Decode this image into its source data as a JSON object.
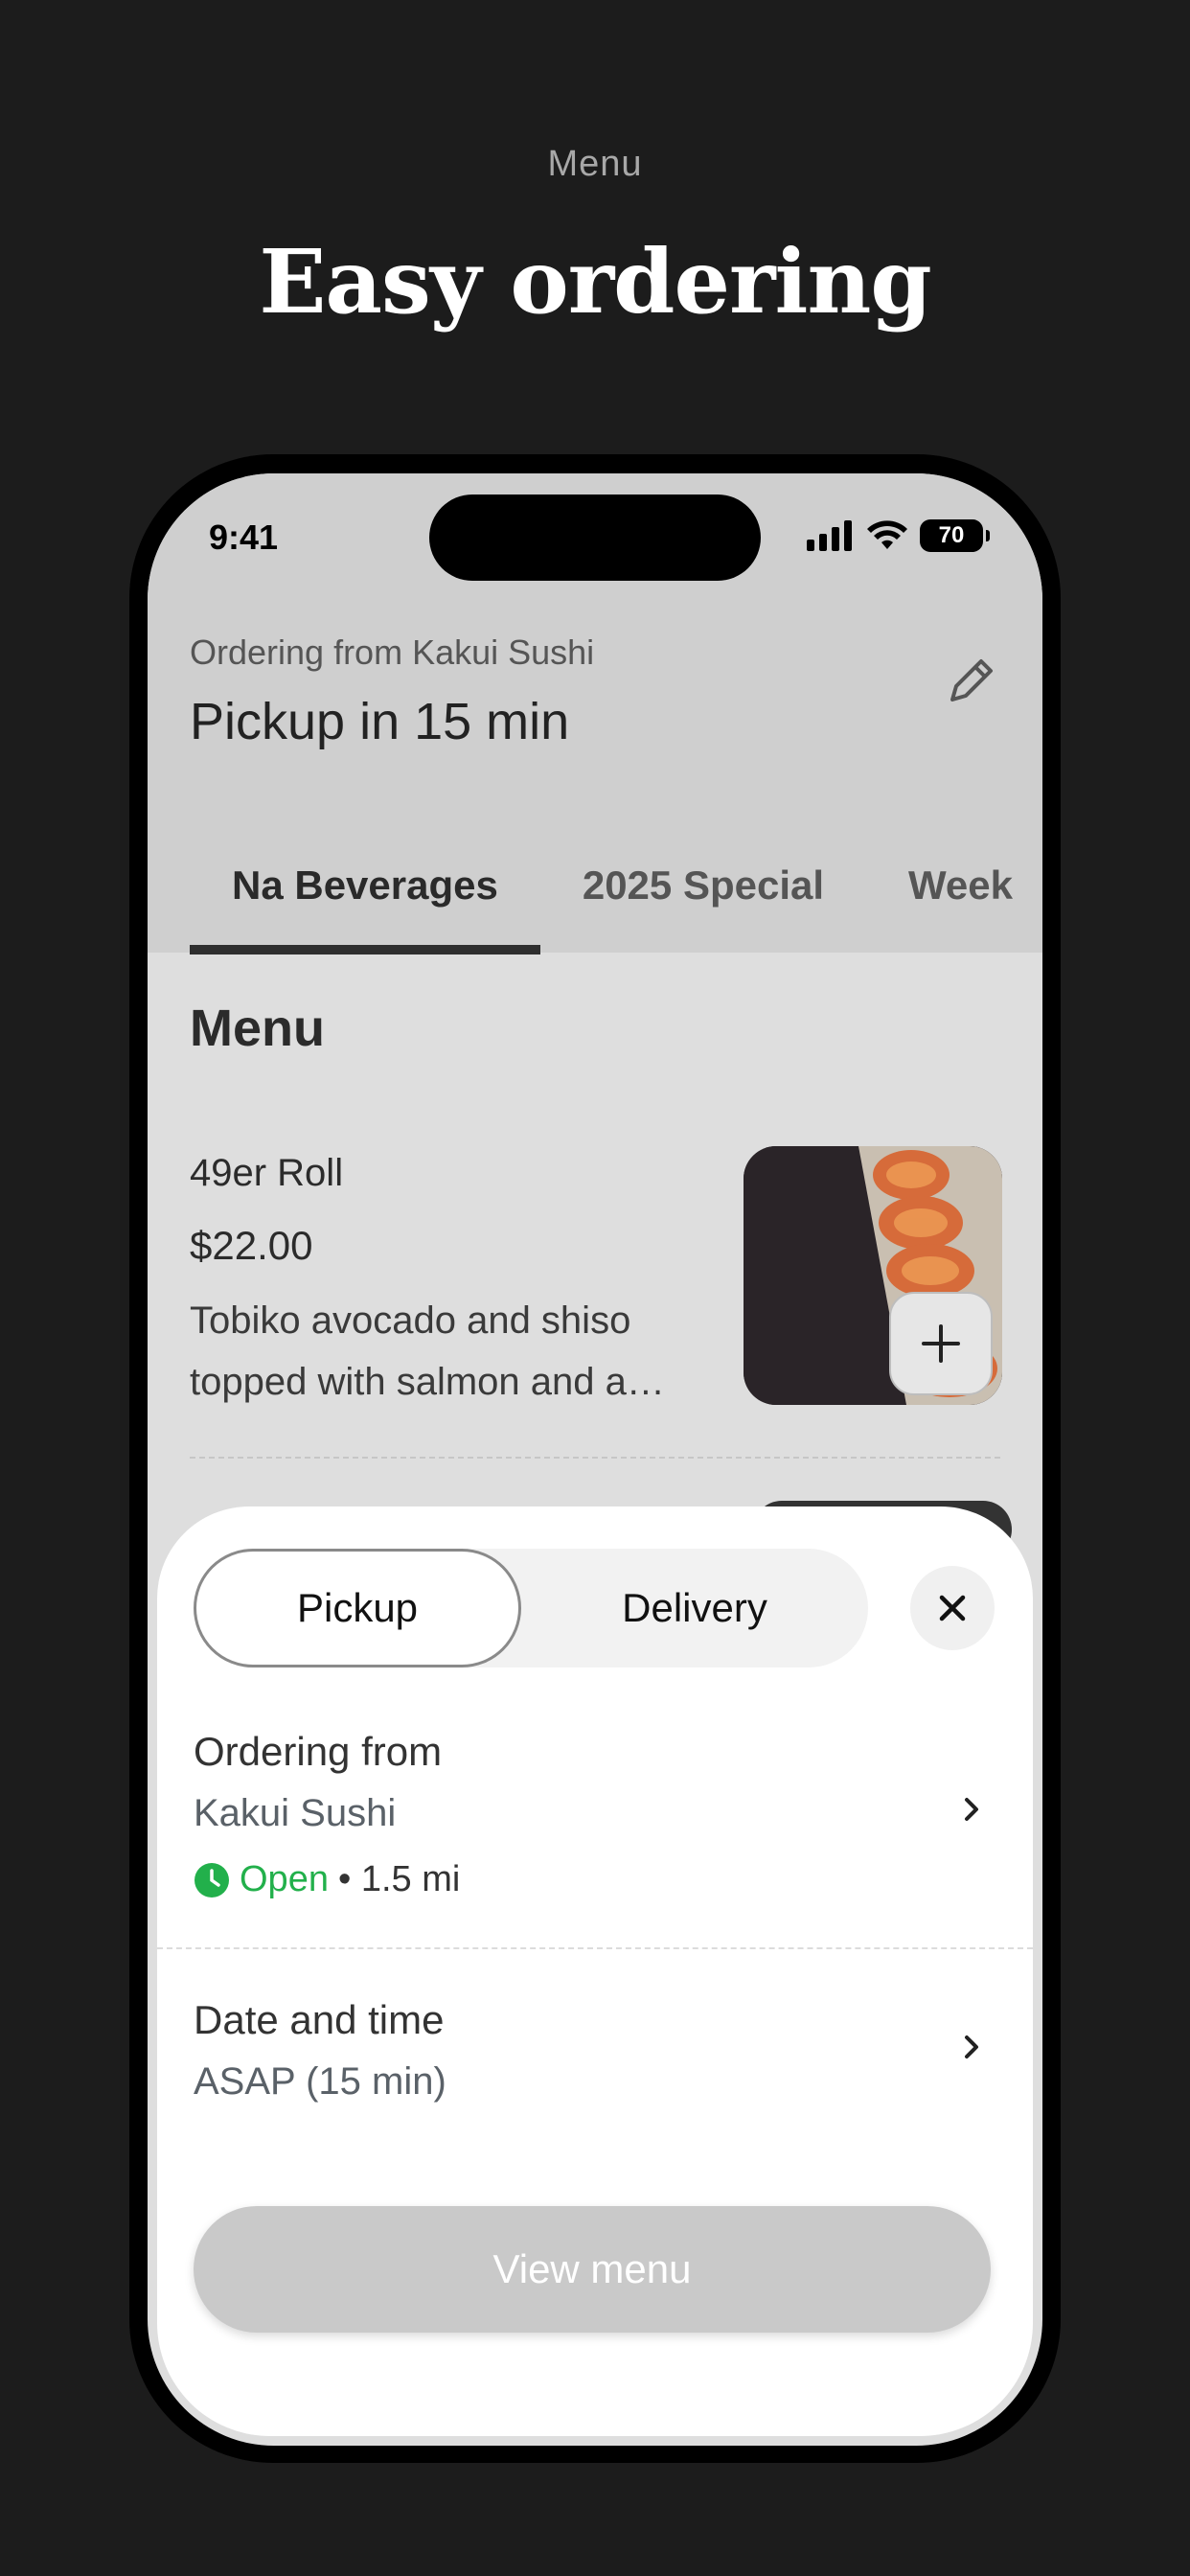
{
  "promo": {
    "kicker": "Menu",
    "title": "Easy ordering"
  },
  "status_bar": {
    "time": "9:41",
    "battery": "70",
    "icons": [
      "signal-icon",
      "wifi-icon",
      "battery-icon"
    ]
  },
  "header": {
    "ordering_from": "Ordering from Kakui Sushi",
    "pickup_eta": "Pickup in 15 min",
    "edit_icon": "pencil-icon"
  },
  "tabs": [
    {
      "label": "Na Beverages",
      "active": true
    },
    {
      "label": "2025 Special",
      "active": false
    },
    {
      "label": "Week",
      "active": false
    }
  ],
  "menu": {
    "heading": "Menu",
    "items": [
      {
        "name": "49er Roll",
        "price": "$22.00",
        "description": "Tobiko avocado and shiso topped with salmon and a…",
        "add_icon": "plus-icon"
      }
    ]
  },
  "sheet": {
    "modes": {
      "pickup": "Pickup",
      "delivery": "Delivery",
      "selected": "Pickup"
    },
    "close_icon": "close-icon",
    "ordering_from": {
      "title": "Ordering from",
      "restaurant": "Kakui Sushi",
      "status": "Open",
      "distance": "• 1.5 mi"
    },
    "date_time": {
      "title": "Date and time",
      "value": "ASAP (15 min)"
    },
    "cta": "View menu"
  },
  "colors": {
    "background": "#1c1c1c",
    "open_green": "#22b04b",
    "cta_disabled": "#c9c9c9"
  }
}
